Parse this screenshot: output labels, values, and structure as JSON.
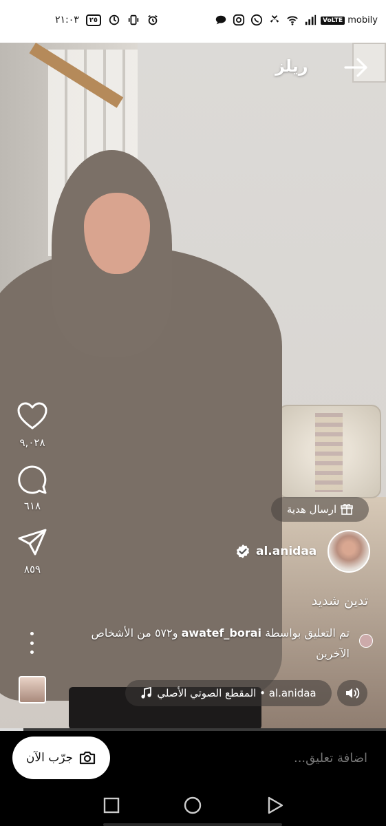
{
  "status_bar": {
    "time": "٢١:٠٣",
    "battery": "٢٥",
    "carrier": "mobily",
    "volte": "VoLTE",
    "network": "4G"
  },
  "header": {
    "title": "ريلز"
  },
  "actions": {
    "likes": "٩,٠٢٨",
    "comments": "٦١٨",
    "shares": "٨٥٩"
  },
  "post": {
    "gift_label": "ارسال هدية",
    "username": "al.anidaa",
    "caption": "تدين شديد",
    "liked_by_prefix": "تم التعليق بواسطة",
    "liked_by_user": "awatef_borai",
    "liked_by_suffix": "و٥٧٢ من الأشخاص الآخرين",
    "audio_label": "al.anidaa • المقطع الصوتي الأصلي"
  },
  "progress": 0.06,
  "comment_bar": {
    "placeholder": "اضافة تعليق...",
    "try_now": "جرّب الآن"
  },
  "colors": {
    "accent_white": "#ffffff",
    "overlay_pill": "rgba(60,56,54,0.55)"
  },
  "icons": [
    "back-arrow-icon",
    "heart-icon",
    "comment-icon",
    "send-icon",
    "more-icon",
    "gift-icon",
    "verified-icon",
    "music-note-icon",
    "speaker-icon",
    "camera-icon",
    "recents-icon",
    "home-icon",
    "back-icon"
  ]
}
